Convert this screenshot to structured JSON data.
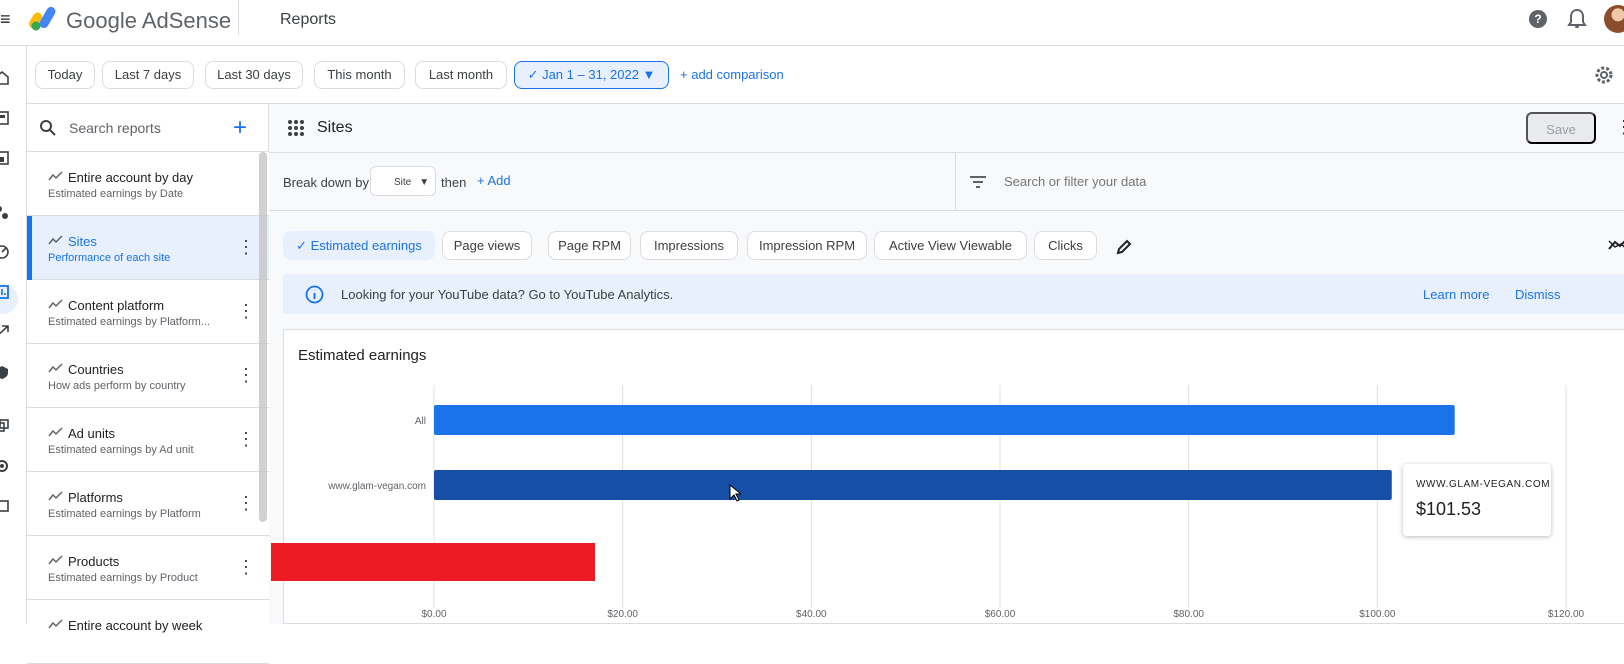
{
  "app": {
    "brand": "Google AdSense",
    "page_title": "Reports"
  },
  "date_filters": {
    "today": "Today",
    "last_7_days": "Last 7 days",
    "last_30_days": "Last 30 days",
    "this_month": "This month",
    "last_month": "Last month",
    "selected_range": "Jan 1 – 31, 2022",
    "add_comparison": "add comparison"
  },
  "sidebar": {
    "search_placeholder": "Search reports",
    "reports": [
      {
        "title": "Entire account by day",
        "subtitle": "Estimated earnings by Date"
      },
      {
        "title": "Sites",
        "subtitle": "Performance of each site"
      },
      {
        "title": "Content platform",
        "subtitle": "Estimated earnings by Platform..."
      },
      {
        "title": "Countries",
        "subtitle": "How ads perform by country"
      },
      {
        "title": "Ad units",
        "subtitle": "Estimated earnings by Ad unit"
      },
      {
        "title": "Platforms",
        "subtitle": "Estimated earnings by Platform"
      },
      {
        "title": "Products",
        "subtitle": "Estimated earnings by Product"
      },
      {
        "title": "Entire account by week",
        "subtitle": ""
      }
    ]
  },
  "main": {
    "title": "Sites",
    "save_label": "Save",
    "breakdown": {
      "label": "Break down by",
      "selected": "Site",
      "then": "then",
      "add": "Add"
    },
    "filter_placeholder": "Search or filter your data",
    "metrics": [
      "Estimated earnings",
      "Page views",
      "Page RPM",
      "Impressions",
      "Impression RPM",
      "Active View Viewable",
      "Clicks"
    ],
    "notice": {
      "text": "Looking for your YouTube data? Go to YouTube Analytics.",
      "learn_more": "Learn more",
      "dismiss": "Dismiss"
    },
    "tooltip": {
      "site": "WWW.GLAM-VEGAN.COM",
      "value": "$101.53"
    }
  },
  "colors": {
    "primary": "#1a73e8",
    "dark_bar": "#174ea6",
    "selected_background": "#e8f0fe",
    "redaction": "#ed1c24"
  },
  "chart_data": {
    "type": "bar",
    "title": "Estimated earnings",
    "categories": [
      "All",
      "www.glam-vegan.com"
    ],
    "values": [
      108.2,
      101.53
    ],
    "xlim": [
      0,
      120
    ],
    "x_ticks": [
      "$0.00",
      "$20.00",
      "$40.00",
      "$60.00",
      "$80.00",
      "$100.00",
      "$120.00"
    ],
    "grid": true,
    "series": [
      {
        "values": [
          108.2,
          101.53
        ]
      }
    ]
  }
}
